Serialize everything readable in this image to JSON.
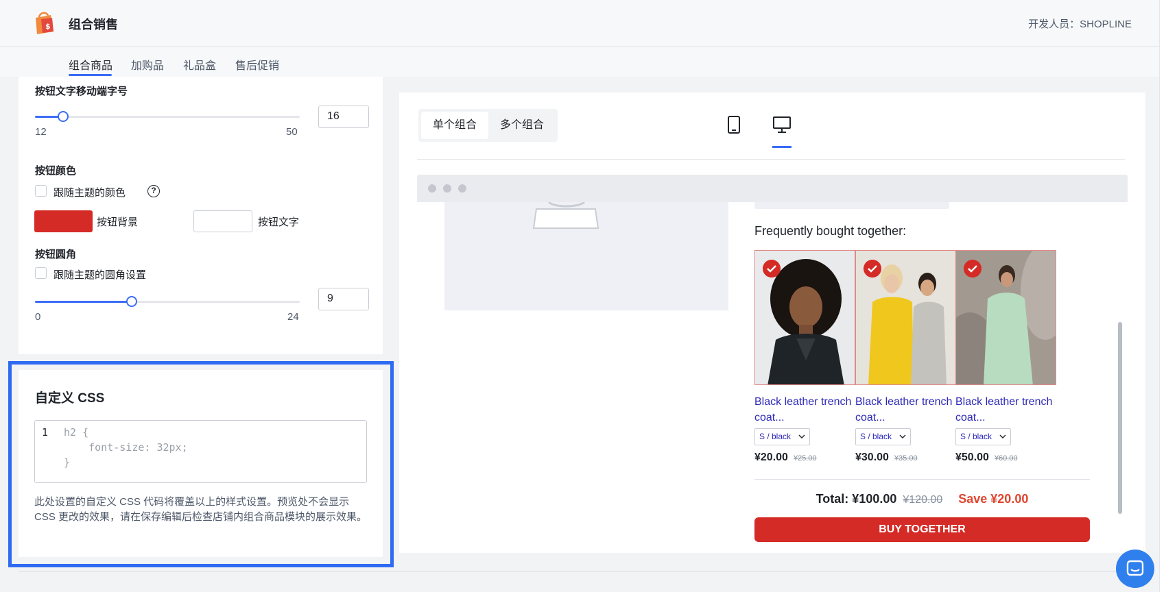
{
  "header": {
    "app_title": "组合销售",
    "developer": "开发人员：SHOPLINE"
  },
  "tabs": [
    {
      "label": "组合商品",
      "active": true
    },
    {
      "label": "加购品",
      "active": false
    },
    {
      "label": "礼品盒",
      "active": false
    },
    {
      "label": "售后促销",
      "active": false
    }
  ],
  "settings": {
    "font_size_label": "按钮文字移动端字号",
    "font_size_min": "12",
    "font_size_max": "50",
    "font_size_value": "16",
    "button_color_label": "按钮颜色",
    "follow_theme_color_label": "跟随主题的颜色",
    "help_icon": "?",
    "bg_label": "按钮背景",
    "text_label": "按钮文字",
    "bg_color": "#d52b26",
    "text_color": "#ffffff",
    "radius_label": "按钮圆角",
    "follow_theme_radius_label": "跟随主题的圆角设置",
    "radius_min": "0",
    "radius_max": "24",
    "radius_value": "9"
  },
  "custom_css": {
    "title": "自定义 CSS",
    "line_number": "1",
    "code_lines": [
      "h2 {",
      "    font-size: 32px;",
      "}"
    ],
    "description": "此处设置的自定义 CSS 代码将覆盖以上的样式设置。预览处不会显示 CSS 更改的效果，请在保存编辑后检查店铺内组合商品模块的展示效果。"
  },
  "preview": {
    "segments": [
      {
        "label": "单个组合",
        "active": true
      },
      {
        "label": "多个组合",
        "active": false
      }
    ],
    "devices": [
      "mobile-icon",
      "desktop-icon"
    ],
    "active_device": "desktop-icon",
    "fbt_title": "Frequently bought together:",
    "products": [
      {
        "name": "Black leather trench coat...",
        "variant": "S / black",
        "price": "¥20.00",
        "old_price": "¥25.00"
      },
      {
        "name": "Black leather trench coat...",
        "variant": "S / black",
        "price": "¥30.00",
        "old_price": "¥35.00"
      },
      {
        "name": "Black leather trench coat...",
        "variant": "S / black",
        "price": "¥50.00",
        "old_price": "¥60.00"
      }
    ],
    "total": "Total: ¥100.00",
    "total_old": "¥120.00",
    "save": "Save ¥20.00",
    "buy_button": "BUY TOGETHER"
  },
  "colors": {
    "accent": "#3b6cf6",
    "highlight": "#2f6bf2",
    "buy": "#d52b26"
  }
}
